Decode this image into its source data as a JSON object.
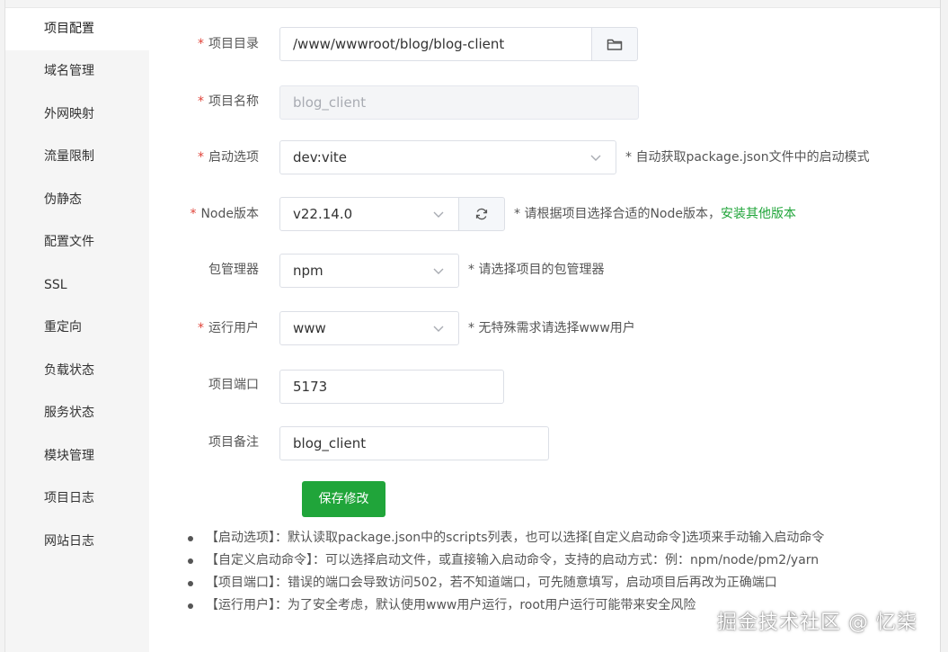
{
  "sidebar": {
    "items": [
      {
        "label": "项目配置",
        "active": true
      },
      {
        "label": "域名管理"
      },
      {
        "label": "外网映射"
      },
      {
        "label": "流量限制"
      },
      {
        "label": "伪静态"
      },
      {
        "label": "配置文件"
      },
      {
        "label": "SSL"
      },
      {
        "label": "重定向"
      },
      {
        "label": "负载状态"
      },
      {
        "label": "服务状态"
      },
      {
        "label": "模块管理"
      },
      {
        "label": "项目日志"
      },
      {
        "label": "网站日志"
      }
    ]
  },
  "form": {
    "required_mark": "*",
    "project_dir": {
      "label": "项目目录",
      "value": "/www/wwwroot/blog/blog-client",
      "icon": "folder-icon"
    },
    "project_name": {
      "label": "项目名称",
      "value": "blog_client"
    },
    "start_option": {
      "label": "启动选项",
      "value": "dev:vite",
      "hint": "* 自动获取package.json文件中的启动模式"
    },
    "node_version": {
      "label": "Node版本",
      "value": "v22.14.0",
      "icon": "refresh-icon",
      "hint": "* 请根据项目选择合适的Node版本，",
      "hint_link": "安装其他版本"
    },
    "package_manager": {
      "label": "包管理器",
      "value": "npm",
      "hint": "* 请选择项目的包管理器"
    },
    "run_user": {
      "label": "运行用户",
      "value": "www",
      "hint": "* 无特殊需求请选择www用户"
    },
    "port": {
      "label": "项目端口",
      "value": "5173"
    },
    "remark": {
      "label": "项目备注",
      "value": "blog_client"
    },
    "save_label": "保存修改"
  },
  "notes": [
    "【启动选项】：默认读取package.json中的scripts列表，也可以选择[自定义启动命令]选项来手动输入启动命令",
    "【自定义启动命令】：可以选择启动文件，或直接输入启动命令，支持的启动方式：例：npm/node/pm2/yarn",
    "【项目端口】：错误的端口会导致访问502，若不知道端口，可先随意填写，启动项目后再改为正确端口",
    "【运行用户】：为了安全考虑，默认使用www用户运行，root用户运行可能带来安全风险"
  ],
  "watermark": "掘金技术社区 @ 忆柒",
  "colors": {
    "accent": "#20a53a",
    "required": "#e0443a"
  }
}
